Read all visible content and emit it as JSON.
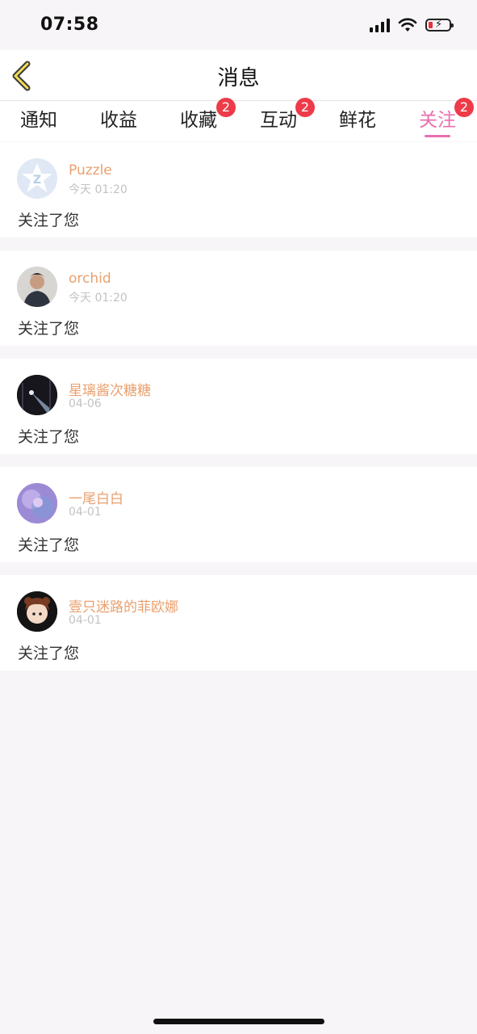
{
  "status_bar": {
    "time": "07:58"
  },
  "header": {
    "title": "消息"
  },
  "tabs": [
    {
      "label": "通知",
      "badge": ""
    },
    {
      "label": "收益",
      "badge": ""
    },
    {
      "label": "收藏",
      "badge": "2"
    },
    {
      "label": "互动",
      "badge": "2"
    },
    {
      "label": "鲜花",
      "badge": ""
    },
    {
      "label": "关注",
      "badge": "2",
      "active": true
    }
  ],
  "items": [
    {
      "name": "Puzzle",
      "date": "今天 01:20",
      "message": "关注了您"
    },
    {
      "name": "orchid",
      "date": "今天 01:20",
      "message": "关注了您"
    },
    {
      "name": "星璃酱次糖糖",
      "date": "04-06",
      "message": "关注了您"
    },
    {
      "name": "一尾白白",
      "date": "04-01",
      "message": "关注了您"
    },
    {
      "name": "壹只迷路的菲欧娜",
      "date": "04-01",
      "message": "关注了您"
    }
  ],
  "colors": {
    "accent": "#ea6fae",
    "badge": "#ee3b49",
    "username": "#e9a06f"
  }
}
